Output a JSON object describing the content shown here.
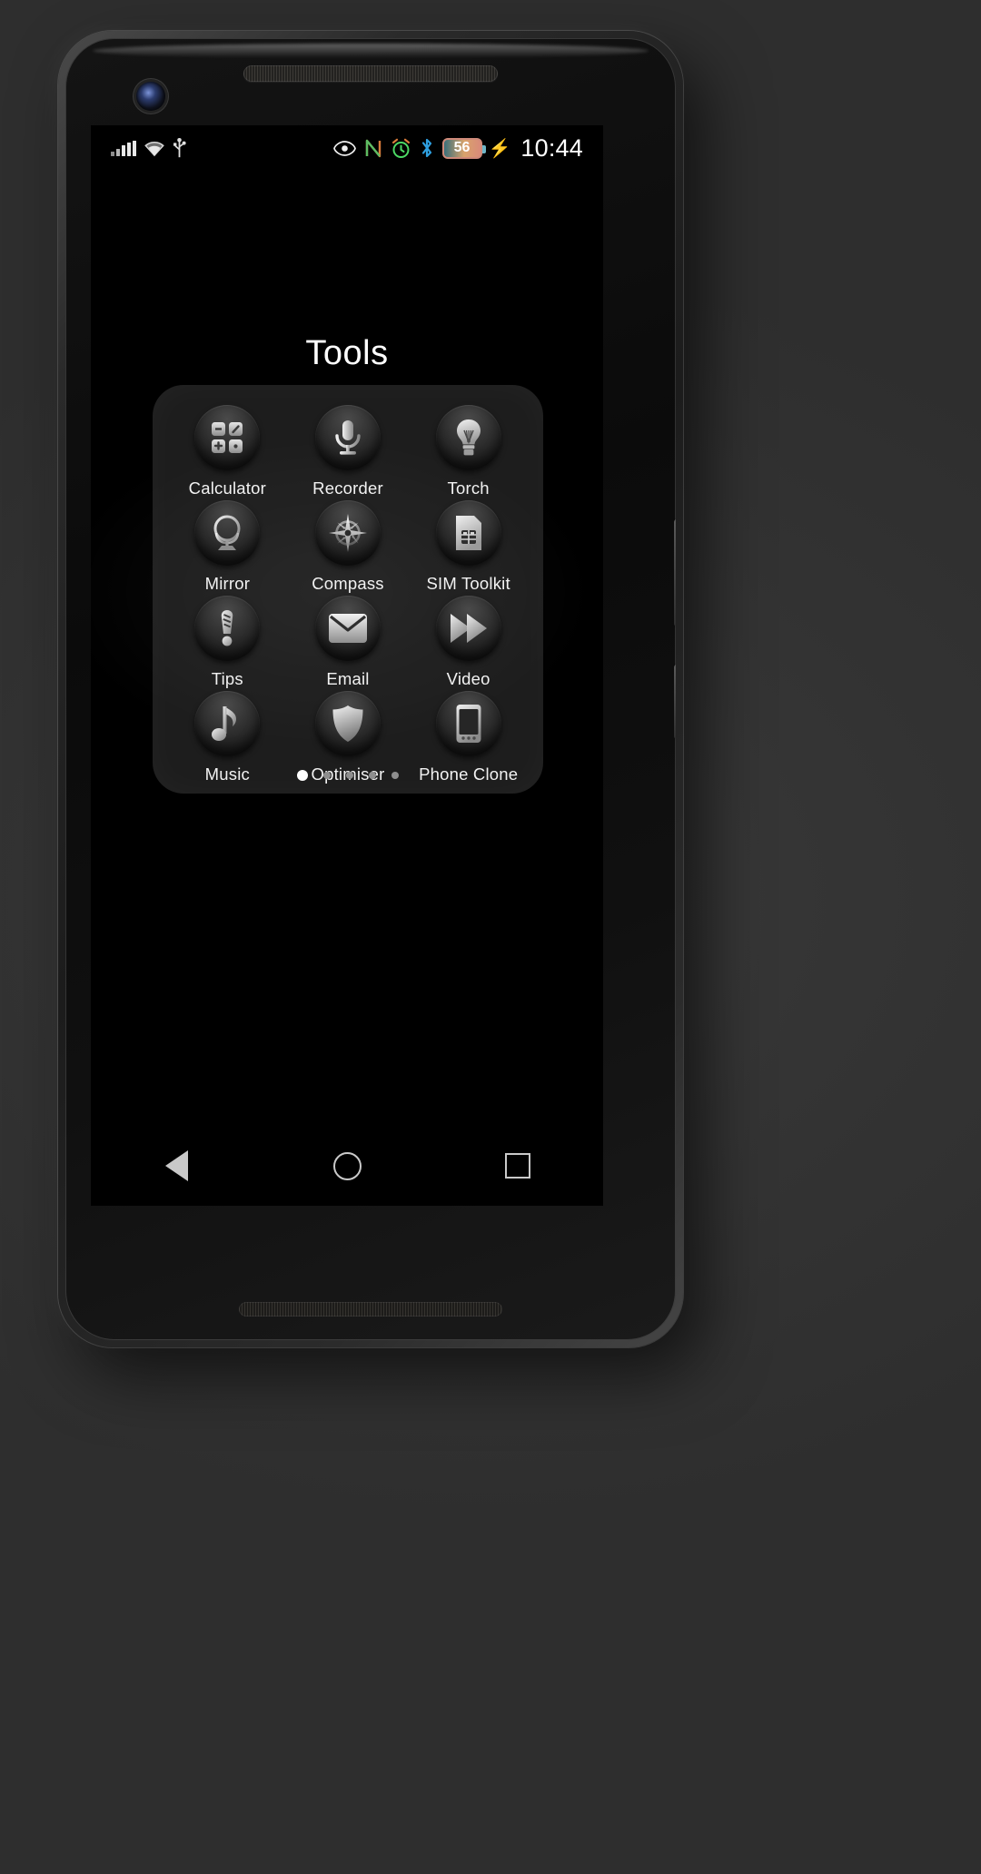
{
  "status_bar": {
    "left_icons": [
      "signal-bars-icon",
      "wifi-icon",
      "usb-icon"
    ],
    "right_icons": [
      "eye-comfort-icon",
      "nfc-icon",
      "alarm-icon",
      "bluetooth-icon"
    ],
    "battery_level": "56",
    "charging": true,
    "time": "10:44"
  },
  "folder": {
    "title": "Tools",
    "apps": [
      {
        "label": "Calculator",
        "icon": "calculator-icon"
      },
      {
        "label": "Recorder",
        "icon": "microphone-icon"
      },
      {
        "label": "Torch",
        "icon": "lightbulb-icon"
      },
      {
        "label": "Mirror",
        "icon": "mirror-icon"
      },
      {
        "label": "Compass",
        "icon": "compass-icon"
      },
      {
        "label": "SIM Toolkit",
        "icon": "sim-card-icon"
      },
      {
        "label": "Tips",
        "icon": "exclamation-icon"
      },
      {
        "label": "Email",
        "icon": "envelope-icon"
      },
      {
        "label": "Video",
        "icon": "play-double-icon"
      },
      {
        "label": "Music",
        "icon": "music-note-icon"
      },
      {
        "label": "Optimiser",
        "icon": "shield-icon"
      },
      {
        "label": "Phone Clone",
        "icon": "phone-device-icon"
      }
    ],
    "page_count": 5,
    "active_page": 1
  },
  "nav_bar": {
    "back_label": "Back",
    "home_label": "Home",
    "recents_label": "Recents"
  },
  "colors": {
    "screen_background": "#000000",
    "panel_fill": "rgba(170,170,170,0.17)",
    "label_text": "#f2f2f2",
    "alarm_green": "#4cd964",
    "bluetooth_blue": "#2e9fe0",
    "nfc_orange": "#d97b3a",
    "active_dot": "#ffffff"
  }
}
